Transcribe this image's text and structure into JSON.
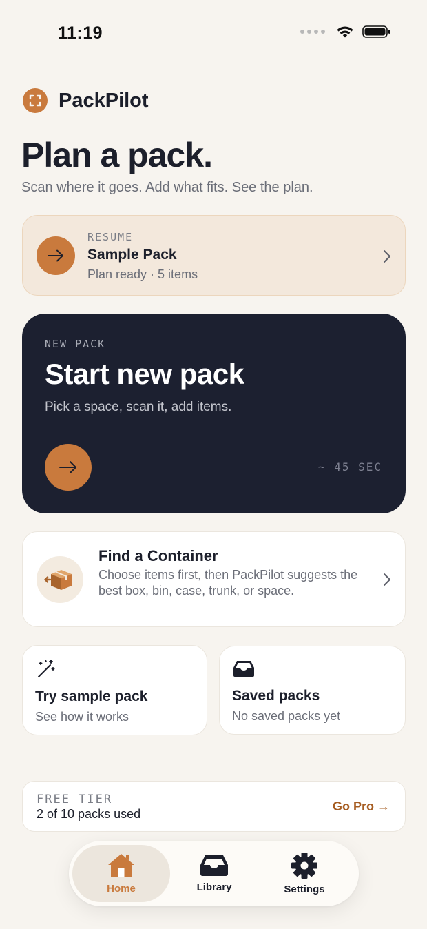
{
  "status_bar": {
    "time": "11:19"
  },
  "brand": {
    "name": "PackPilot"
  },
  "hero": {
    "title": "Plan a pack.",
    "subtitle": "Scan where it goes. Add what fits. See the plan."
  },
  "resume": {
    "eyebrow": "RESUME",
    "title": "Sample Pack",
    "meta": "Plan ready · 5 items"
  },
  "new_pack": {
    "eyebrow": "NEW PACK",
    "title": "Start new pack",
    "description": "Pick a space, scan it, add items.",
    "duration": "~ 45 SEC"
  },
  "find_container": {
    "title": "Find a Container",
    "description": "Choose items first, then PackPilot suggests the best box, bin, case, trunk, or space."
  },
  "sample_pack": {
    "title": "Try sample pack",
    "description": "See how it works"
  },
  "saved_packs": {
    "title": "Saved packs",
    "description": "No saved packs yet"
  },
  "free_tier": {
    "eyebrow": "FREE TIER",
    "usage": "2 of 10 packs used",
    "upgrade_label": "Go Pro →"
  },
  "tabbar": {
    "tabs": [
      {
        "label": "Home",
        "icon": "house-icon",
        "active": true
      },
      {
        "label": "Library",
        "icon": "tray-icon",
        "active": false
      },
      {
        "label": "Settings",
        "icon": "gear-icon",
        "active": false
      }
    ]
  },
  "colors": {
    "background": "#f7f4ef",
    "accent": "#c97a3d",
    "dark_card": "#1c2030",
    "resume_card": "#f3e8dc",
    "pro_link": "#a65d22"
  }
}
